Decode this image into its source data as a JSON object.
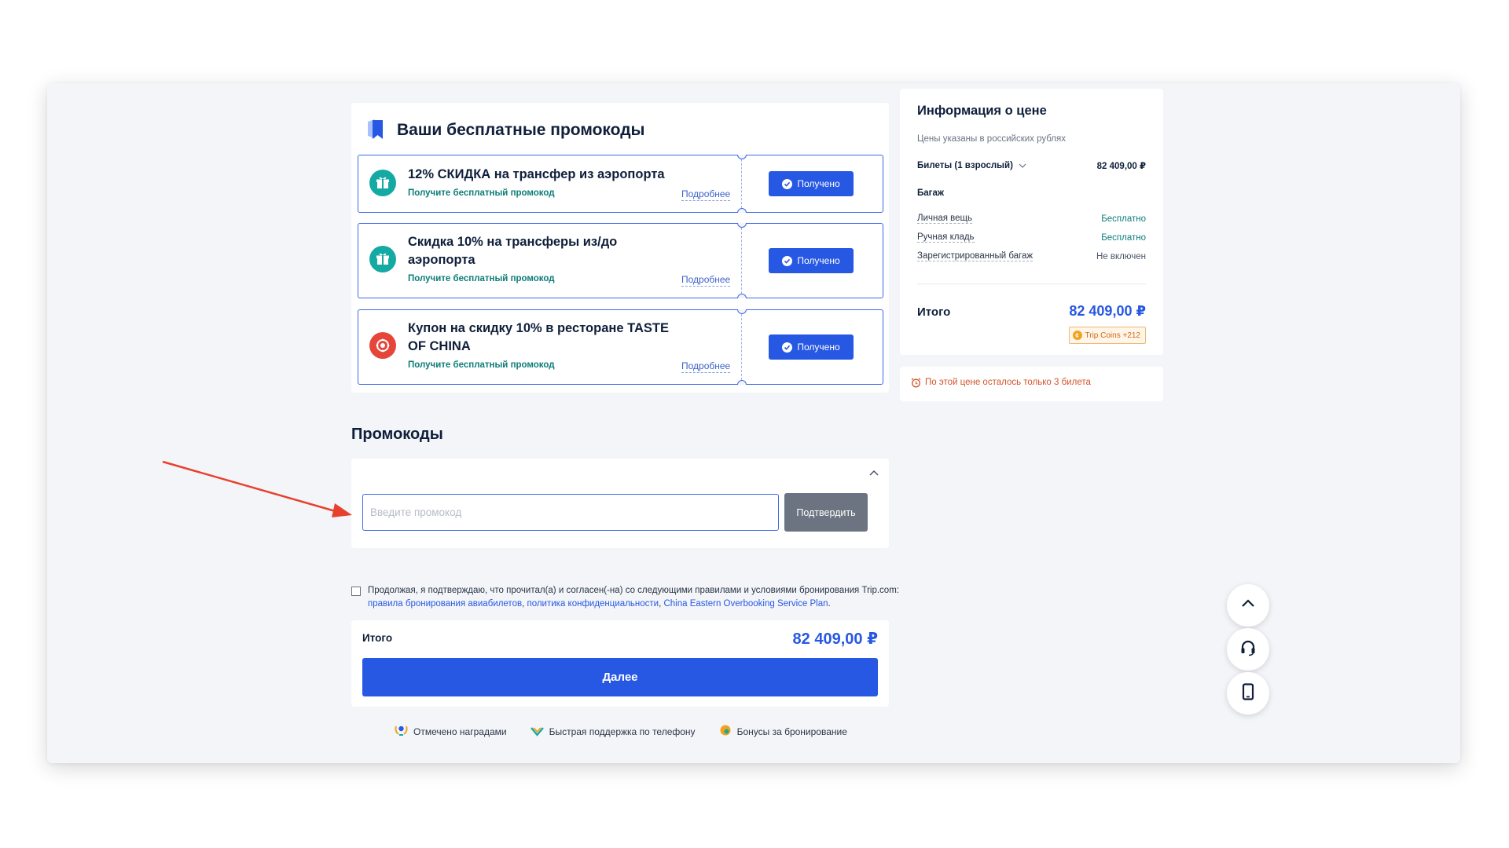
{
  "promo_section": {
    "title": "Ваши бесплатные промокоды",
    "coupons": [
      {
        "title": "12% СКИДКА на трансфер из аэропорта",
        "subtitle": "Получите бесплатный промокод",
        "more": "Подробнее",
        "button": "Получено",
        "icon": "gift-icon",
        "icon_color": "#14a9a3"
      },
      {
        "title": "Скидка 10% на трансферы из/до аэропорта",
        "subtitle": "Получите бесплатный промокод",
        "more": "Подробнее",
        "button": "Получено",
        "icon": "gift-icon",
        "icon_color": "#14a9a3"
      },
      {
        "title": "Купон на скидку 10% в ресторане TASTE OF CHINA",
        "subtitle": "Получите бесплатный промокод",
        "more": "Подробнее",
        "button": "Получено",
        "icon": "restaurant-icon",
        "icon_color": "#e6453a"
      }
    ]
  },
  "promo_input": {
    "title": "Промокоды",
    "placeholder": "Введите промокод",
    "value": "",
    "confirm": "Подтвердить"
  },
  "terms": {
    "text": "Продолжая, я подтверждаю, что прочитал(а) и согласен(-на) со следующими правилами и условиями бронирования Trip.com: ",
    "link1": "правила бронирования авиабилетов",
    "sep1": ", ",
    "link2": "политика конфиденциальности",
    "sep2": ", ",
    "link3": "China Eastern Overbooking Service Plan",
    "end": "."
  },
  "total": {
    "label": "Итого",
    "value": "82 409,00 ₽",
    "next": "Далее"
  },
  "badges": [
    {
      "label": "Отмечено наградами",
      "icon": "award-icon"
    },
    {
      "label": "Быстрая поддержка по телефону",
      "icon": "heart-check-icon"
    },
    {
      "label": "Бонусы за бронирование",
      "icon": "coin-icon"
    }
  ],
  "price_info": {
    "title": "Информация о цене",
    "subtitle": "Цены указаны в российских рублях",
    "tickets_label": "Билеты (1 взрослый)",
    "tickets_value": "82 409,00 ₽",
    "baggage_title": "Багаж",
    "baggage": [
      {
        "label": "Личная вещь",
        "value": "Бесплатно"
      },
      {
        "label": "Ручная кладь",
        "value": "Бесплатно"
      },
      {
        "label": "Зарегистрированный багаж",
        "value": "Не включен"
      }
    ],
    "total_label": "Итого",
    "total_value": "82 409,00 ₽",
    "coins": "Trip Coins +212"
  },
  "warning": {
    "text": "По этой цене осталось только 3 билета"
  },
  "colors": {
    "accent": "#2758e3",
    "teal": "#0c7d78",
    "warning": "#d2552a",
    "annotation_arrow": "#e8402f"
  }
}
